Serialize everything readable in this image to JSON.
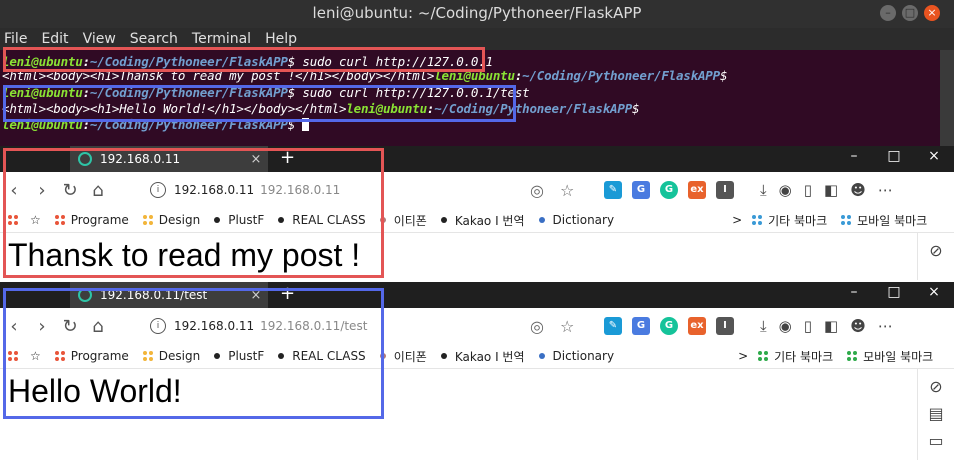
{
  "terminal": {
    "title": "leni@ubuntu: ~/Coding/Pythoneer/FlaskAPP",
    "menu": [
      "File",
      "Edit",
      "View",
      "Search",
      "Terminal",
      "Help"
    ],
    "prompt_user": "leni@ubuntu",
    "prompt_path": "~/Coding/Pythoneer/FlaskAPP",
    "lines": {
      "cmd1": "sudo curl http://127.0.0.1",
      "out1": "<html><body><h1>Thansk to read my post !</h1></body></html>",
      "cmd2": "sudo curl http://127.0.0.1/test",
      "out2": "<html><body><h1>Hello World!</h1></body></html>"
    },
    "controls": {
      "min": "–",
      "max": "□",
      "close": "×"
    }
  },
  "browser1": {
    "tab_title": "192.168.0.11",
    "url_host": "192.168.0.11",
    "url_full": "192.168.0.11",
    "page_heading": "Thansk to read my post !"
  },
  "browser2": {
    "tab_title": "192.168.0.11/test",
    "url_host": "192.168.0.11",
    "url_full": "192.168.0.11/test",
    "page_heading": "Hello World!"
  },
  "bookmarks": {
    "star": "☆",
    "items": [
      "Programe",
      "Design",
      "PlustF",
      "REAL CLASS",
      "이티폰",
      "Kakao I 번역",
      "Dictionary"
    ],
    "more": ">",
    "other": "기타 북마크",
    "mobile": "모바일 북마크"
  },
  "ui": {
    "close_tab": "×",
    "new_tab": "+",
    "win_min": "–",
    "win_max": "□",
    "win_close": "×",
    "back": "‹",
    "forward": "›",
    "reload": "↻",
    "home": "⌂",
    "info": "i"
  },
  "colors": {
    "highlight_red": "#e35555",
    "highlight_blue": "#5468e8",
    "terminal_bg": "#300a24",
    "prompt_user": "#8ae234",
    "prompt_path": "#729fcf"
  }
}
